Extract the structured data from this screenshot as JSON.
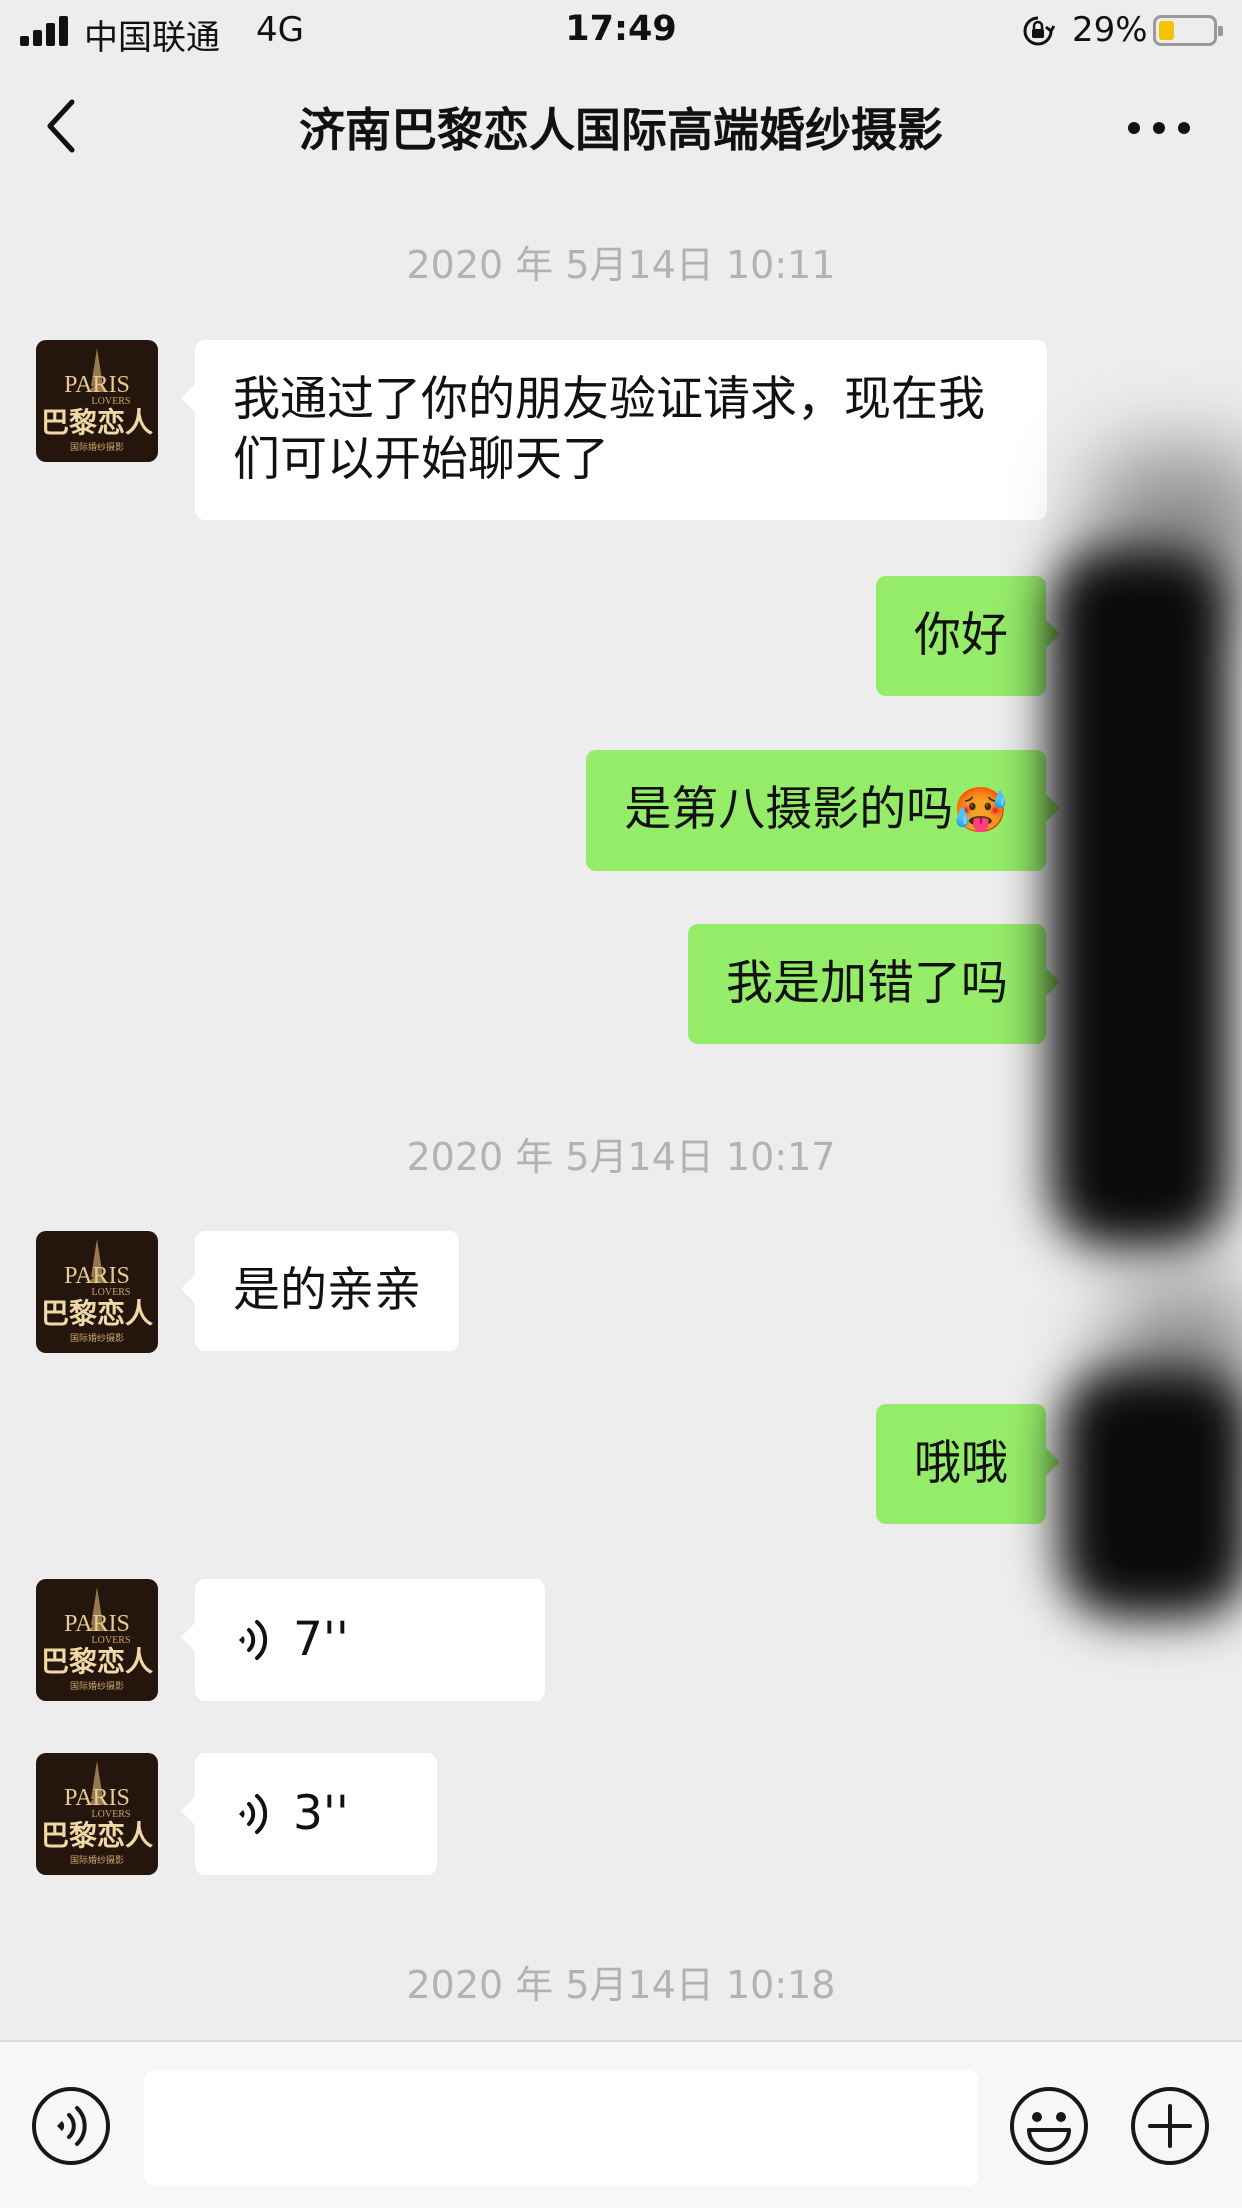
{
  "status_bar": {
    "carrier": "中国联通",
    "network": "4G",
    "time": "17:49",
    "battery_percent": "29%",
    "battery_level": 0.29,
    "icons": [
      "signal-icon",
      "orientation-lock-icon",
      "battery-icon"
    ]
  },
  "nav": {
    "title": "济南巴黎恋人国际高端婚纱摄影",
    "back_icon": "chevron-left-icon",
    "more_icon": "more-dots-icon"
  },
  "chat": {
    "timestamps": [
      "2020 年 5月14日 10:11",
      "2020 年 5月14日 10:17",
      "2020 年 5月14日 10:18"
    ],
    "contact_avatar": {
      "logo_text": "PARIS",
      "logo_subtext": "LOVERS",
      "logo_chinese": "巴黎恋人",
      "logo_small": "国际婚纱摄影"
    },
    "messages": [
      {
        "side": "left",
        "text": "我通过了你的朋友验证请求，现在我们可以开始聊天了"
      },
      {
        "side": "right",
        "text": "你好"
      },
      {
        "side": "right",
        "text": "是第八摄影的吗",
        "emoji": "🥵"
      },
      {
        "side": "right",
        "text": "我是加错了吗"
      },
      {
        "side": "left",
        "text": "是的亲亲"
      },
      {
        "side": "right",
        "text": "哦哦"
      },
      {
        "side": "left",
        "type": "voice",
        "duration": "7''"
      },
      {
        "side": "left",
        "type": "voice",
        "duration": "3''"
      }
    ]
  },
  "input_bar": {
    "voice_icon": "voice-input-icon",
    "emoji_icon": "emoji-icon",
    "plus_icon": "plus-icon",
    "text_value": ""
  },
  "colors": {
    "background": "#ededed",
    "bubble_right": "#95ec69",
    "bubble_left": "#ffffff",
    "timestamp": "#b2b2b2",
    "battery_fill": "#f5c400"
  }
}
